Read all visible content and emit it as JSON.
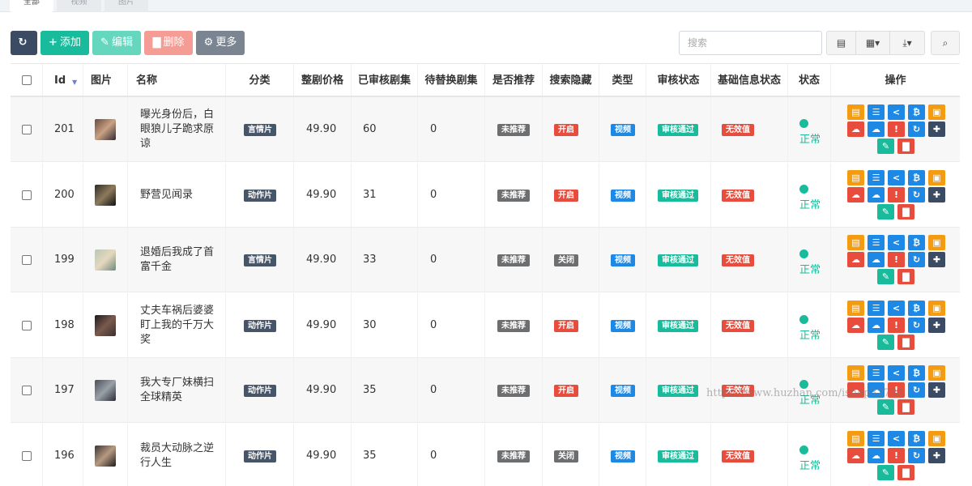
{
  "tabs": [
    {
      "label": "全部"
    },
    {
      "label": "视频"
    },
    {
      "label": "图片"
    }
  ],
  "toolbar": {
    "refresh_icon": "↻",
    "add_label": "添加",
    "add_icon": "+",
    "edit_label": "编辑",
    "edit_icon": "✎",
    "delete_label": "删除",
    "delete_icon": "▇",
    "more_label": "更多",
    "more_icon": "⚙"
  },
  "search": {
    "placeholder": "搜索"
  },
  "right_toolbar": {
    "view_icon": "▤",
    "columns_icon": "▦▾",
    "export_icon": "⤓▾",
    "search_icon": "⌕"
  },
  "table": {
    "headers": [
      "Id",
      "图片",
      "名称",
      "分类",
      "整剧价格",
      "已审核剧集",
      "待替换剧集",
      "是否推荐",
      "搜索隐藏",
      "类型",
      "审核状态",
      "基础信息状态",
      "状态",
      "操作"
    ],
    "rows": [
      {
        "id": "201",
        "name": "曝光身份后，白眼狼儿子跪求原谅",
        "category": "言情片",
        "price": "49.90",
        "reviewed": "60",
        "pending": "0",
        "recommend": "未推荐",
        "hidden": "开启",
        "type": "视频",
        "audit": "审核通过",
        "base": "无效值",
        "status": "正常",
        "thumb": [
          "#6a4b3c",
          "#c9a184",
          "#2e2a30"
        ]
      },
      {
        "id": "200",
        "name": "野营见闻录",
        "category": "动作片",
        "price": "49.90",
        "reviewed": "31",
        "pending": "0",
        "recommend": "未推荐",
        "hidden": "开启",
        "type": "视频",
        "audit": "审核通过",
        "base": "无效值",
        "status": "正常",
        "thumb": [
          "#2f2b24",
          "#8d7a5c",
          "#111"
        ]
      },
      {
        "id": "199",
        "name": "退婚后我成了首富千金",
        "category": "言情片",
        "price": "49.90",
        "reviewed": "33",
        "pending": "0",
        "recommend": "未推荐",
        "hidden": "关闭",
        "type": "视频",
        "audit": "审核通过",
        "base": "无效值",
        "status": "正常",
        "thumb": [
          "#b9c7b4",
          "#e5d8bf",
          "#6f8a7b"
        ]
      },
      {
        "id": "198",
        "name": "丈夫车祸后婆婆盯上我的千万大奖",
        "category": "动作片",
        "price": "49.90",
        "reviewed": "30",
        "pending": "0",
        "recommend": "未推荐",
        "hidden": "开启",
        "type": "视频",
        "audit": "审核通过",
        "base": "无效值",
        "status": "正常",
        "thumb": [
          "#1d1a1c",
          "#7a5a4e",
          "#3a2f2e"
        ]
      },
      {
        "id": "197",
        "name": "我大专厂妹横扫全球精英",
        "category": "动作片",
        "price": "49.90",
        "reviewed": "35",
        "pending": "0",
        "recommend": "未推荐",
        "hidden": "开启",
        "type": "视频",
        "audit": "审核通过",
        "base": "无效值",
        "status": "正常",
        "thumb": [
          "#4b4f58",
          "#9aa0a8",
          "#2b2d33"
        ]
      },
      {
        "id": "196",
        "name": "裁员大动脉之逆行人生",
        "category": "动作片",
        "price": "49.90",
        "reviewed": "35",
        "pending": "0",
        "recommend": "未推荐",
        "hidden": "关闭",
        "type": "视频",
        "audit": "审核通过",
        "base": "无效值",
        "status": "正常",
        "thumb": [
          "#3b3431",
          "#b69a82",
          "#1f1c1c"
        ]
      }
    ]
  },
  "ops_icons": [
    "▤",
    "☰",
    "<",
    "₿",
    "▣",
    "☁",
    "☁",
    "!",
    "↻",
    "✚",
    "✎",
    "▇"
  ],
  "colors": {
    "dark": "#3c4b64",
    "primary_green": "#18bc9c",
    "edit": "#65d7be",
    "delete": "#f59d95",
    "more": "#7b8591",
    "label_dark": "#475569",
    "label_gray": "#6d6e70",
    "label_red": "#e74c3c",
    "label_blue": "#1e88e5",
    "op_orange": "#f39c12",
    "op_blue": "#1e88e5",
    "op_red": "#e74c3c"
  },
  "watermark": "https://www.huzhan.com/ishop32738"
}
